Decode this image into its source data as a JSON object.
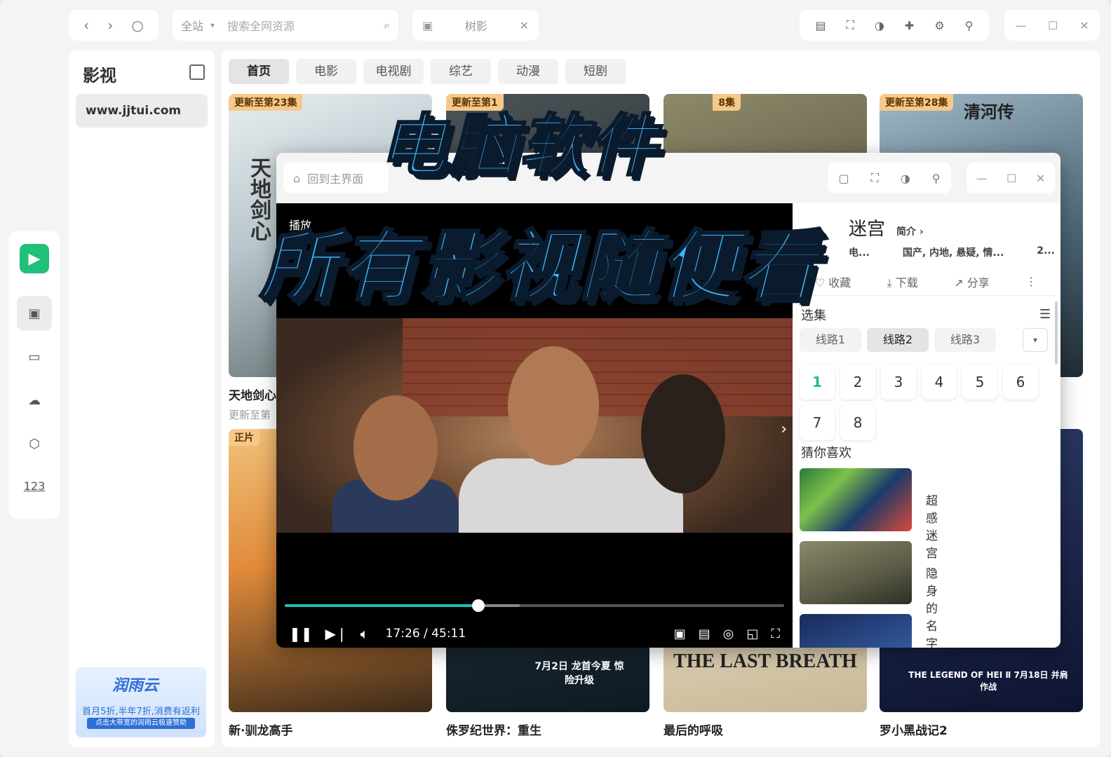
{
  "topbar": {
    "scope": "全站",
    "search_placeholder": "搜索全网资源",
    "tab_name": "树影"
  },
  "sidebar": {
    "title": "影视",
    "site": "www.jjtui.com",
    "ad": {
      "brand": "润雨云",
      "promo": "首月5折,半年7折,消费有返利",
      "cta": "点击大带宽的润雨云极速赞助"
    }
  },
  "rail": {
    "logo_glyph": "▶",
    "items": [
      "movie-clapper-icon",
      "monitor-icon",
      "cloud-icon",
      "box-scan-icon",
      "number-123-icon"
    ],
    "label_123": "123"
  },
  "categories": [
    "首页",
    "电影",
    "电视剧",
    "综艺",
    "动漫",
    "短剧"
  ],
  "cards_top": [
    {
      "badge": "更新至第23集",
      "title": "天地剑心",
      "subtitle": "更新至第",
      "poster_text": "天地剑心"
    },
    {
      "badge": "更新至第1",
      "title": "",
      "subtitle": "",
      "poster_text": ""
    },
    {
      "badge": "8集",
      "title": "",
      "subtitle": "",
      "poster_text": ""
    },
    {
      "badge": "更新至第28集",
      "title": "",
      "subtitle": "",
      "poster_text": "清河传"
    }
  ],
  "cards_bottom": [
    {
      "badge": "正片",
      "title": "新·驯龙高手",
      "poster_text": ""
    },
    {
      "badge": "",
      "title": "侏罗纪世界：重生",
      "poster_text": "7月2日 龙首今夏 惊险升级"
    },
    {
      "badge": "",
      "title": "最后的呼吸",
      "poster_text": "THE LAST BREATH"
    },
    {
      "badge": "",
      "title": "罗小黑战记2",
      "poster_text": "THE LEGEND OF HEI Ⅱ 7月18日 并肩作战"
    }
  ],
  "player": {
    "home_label": "回到主界面",
    "video_label": "播放",
    "time": "17:26 / 45:11",
    "progress": 0.387,
    "buffered": 0.47,
    "info": {
      "title": "迷宫",
      "intro": "简介 ›",
      "meta": [
        "电...",
        "国产, 内地, 悬疑, 情...",
        "2..."
      ],
      "actions": [
        "♡ 收藏",
        "⤓ 下载",
        "↗ 分享",
        "⋮"
      ],
      "episodes_title": "选集",
      "lines": [
        "线路1",
        "线路2",
        "线路3"
      ],
      "active_line": 1,
      "episodes": [
        "1",
        "2",
        "3",
        "4",
        "5",
        "6",
        "7",
        "8"
      ],
      "active_episode": 0,
      "recommend_title": "猜你喜欢",
      "recommendations": [
        "超感迷宫",
        "隐身的名字",
        ""
      ]
    }
  },
  "overlay": {
    "line1": "电脑软件",
    "line2": "所有影视随便看"
  },
  "colors": {
    "accent": "#1fc077",
    "progress": "#1fc0b0",
    "badge": "#f6c98b",
    "slogan": "#3fb4f6"
  }
}
